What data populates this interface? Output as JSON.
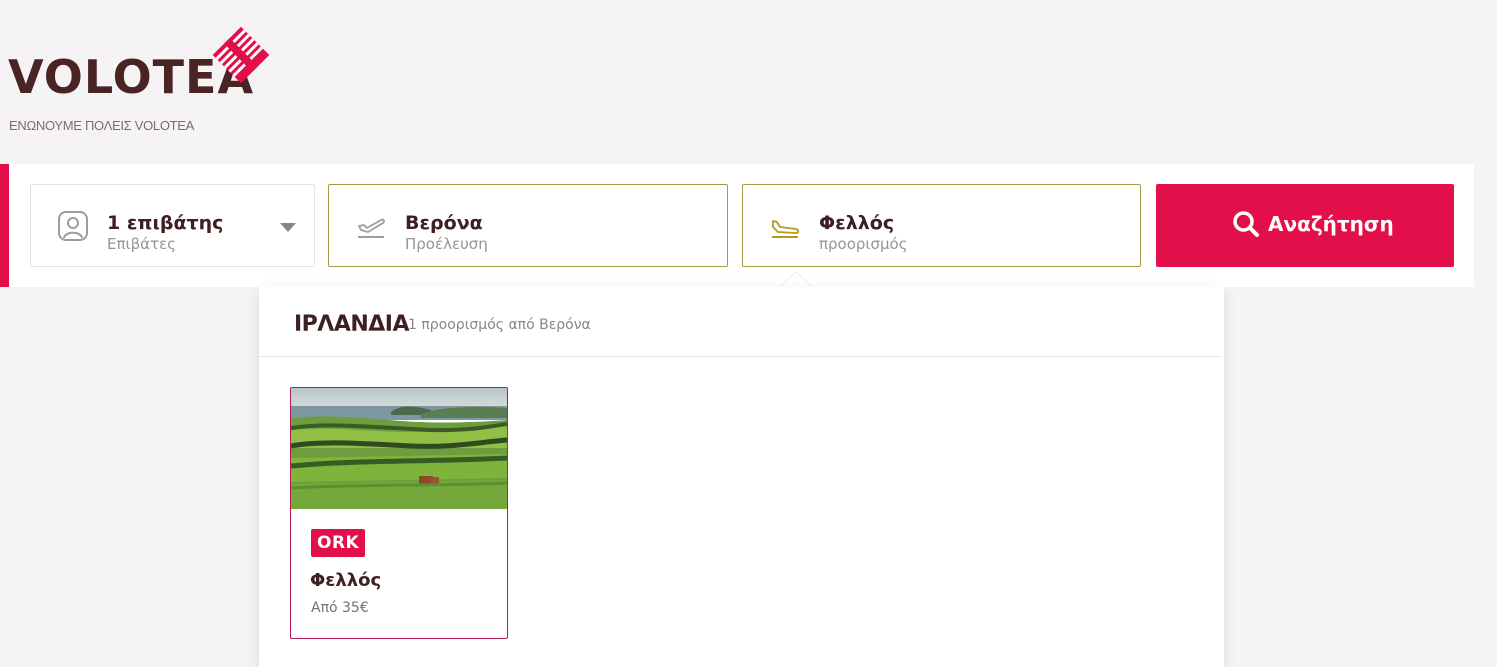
{
  "brand": {
    "name": "VOLOTEA",
    "tagline": "ΕΝΩΝΟΥΜΕ ΠΟΛΕΙΣ VOLOTEA",
    "primary_color": "#e30f4b",
    "dark_color": "#4a2323"
  },
  "search": {
    "passengers": {
      "value": "1 επιβάτης",
      "label": "Επιβάτες",
      "icon": "person-icon"
    },
    "origin": {
      "value": "Βερόνα",
      "label": "Προέλευση",
      "icon": "plane-takeoff-icon"
    },
    "destination": {
      "value": "Φελλός",
      "label": "προορισμός",
      "icon": "plane-landing-icon"
    },
    "button_label": "Αναζήτηση",
    "button_icon": "search-icon"
  },
  "dropdown": {
    "country": "ΙΡΛΑΝΔΙΑ",
    "count_text": "1 προορισμός από Βερόνα",
    "destinations": [
      {
        "iata": "ORK",
        "city": "Φελλός",
        "price": "Από 35€",
        "image": "green-fields-coast-photo"
      }
    ]
  }
}
